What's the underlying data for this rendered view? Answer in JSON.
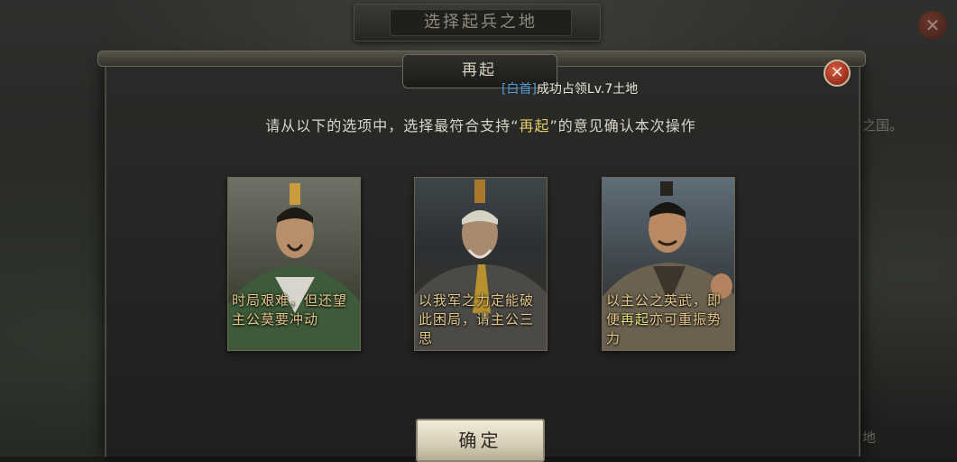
{
  "background": {
    "title": "选择起兵之地",
    "side_text": "之国。",
    "bottom_text": "地"
  },
  "dialog": {
    "title": "再起",
    "close_label": "✕",
    "notice": {
      "tag": "[白首]",
      "text": "成功占领Lv.7土地"
    },
    "instruction": {
      "before": "请从以下的选项中，选择最符合支持“",
      "highlight": "再起",
      "after": "”的意见确认本次操作"
    },
    "options": [
      {
        "text": "时局艰难，但还望主公莫要冲动"
      },
      {
        "text": "以我军之力定能破此困局，请主公三思"
      },
      {
        "before": "以主公之英武，即便",
        "highlight": "再起",
        "after": "亦可重振势力"
      }
    ],
    "confirm_label": "确定"
  },
  "colors": {
    "accent_gold": "#e3c78a",
    "highlight_yellow": "#e2c96b",
    "tag_blue": "#4f9ad8",
    "close_red": "#d85a3e"
  }
}
